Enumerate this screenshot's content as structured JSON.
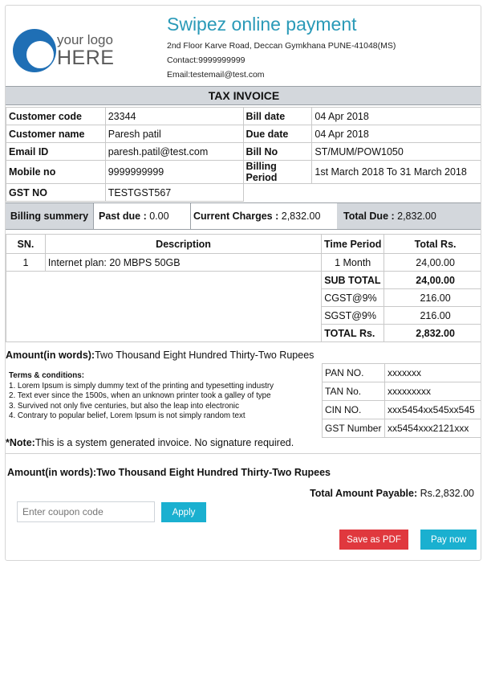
{
  "header": {
    "logo_small": "your logo",
    "logo_big": "HERE",
    "company": "Swipez online payment",
    "address": "2nd Floor Karve Road, Deccan Gymkhana PUNE-41048(MS)",
    "contact": "Contact:9999999999",
    "email": "Email:testemail@test.com"
  },
  "invoice_title": "TAX INVOICE",
  "customer": {
    "code_label": "Customer code",
    "code": "23344",
    "name_label": "Customer name",
    "name": "Paresh patil",
    "email_label": "Email ID",
    "email": "paresh.patil@test.com",
    "mobile_label": "Mobile no",
    "mobile": "9999999999",
    "gst_label": "GST NO",
    "gst": "TESTGST567"
  },
  "bill": {
    "date_label": "Bill date",
    "date": "04 Apr 2018",
    "due_label": "Due date",
    "due": "04 Apr 2018",
    "no_label": "Bill No",
    "no": "ST/MUM/POW1050",
    "period_label": "Billing Period",
    "period": "1st March 2018 To 31 March 2018"
  },
  "summary": {
    "label": "Billing summery",
    "past_label": "Past due :",
    "past": " 0.00",
    "current_label": "Current Charges :",
    "current": " 2,832.00",
    "total_label": "Total Due :",
    "total": " 2,832.00"
  },
  "table": {
    "headers": [
      "SN.",
      "Description",
      "Time Period",
      "Total Rs."
    ],
    "rows": [
      {
        "sn": "1",
        "desc": "Internet plan: 20 MBPS 50GB",
        "period": "1 Month",
        "total": "24,00.00"
      }
    ],
    "subtotal_label": "SUB TOTAL",
    "subtotal": "24,00.00",
    "cgst_label": "CGST@9%",
    "cgst": "216.00",
    "sgst_label": "SGST@9%",
    "sgst": "216.00",
    "total_label": "TOTAL Rs.",
    "total": "2,832.00"
  },
  "amount_words_label": "Amount(in words):",
  "amount_words": "Two Thousand Eight Hundred Thirty-Two Rupees",
  "terms": {
    "title": "Terms & conditions:",
    "lines": [
      "1. Lorem Ipsum is simply dummy text of the printing and typesetting industry",
      "2. Text ever since the 1500s, when an unknown printer took a galley of type",
      "3. Survived not only five centuries, but also the leap into electronic",
      "4. Contrary to popular belief, Lorem Ipsum is not simply random text"
    ]
  },
  "ids": {
    "pan_label": "PAN NO.",
    "pan": "xxxxxxx",
    "tan_label": "TAN No.",
    "tan": "xxxxxxxxx",
    "cin_label": "CIN NO.",
    "cin": "xxx5454xx545xx545",
    "gst_label": "GST Number",
    "gst": "xx5454xxx2121xxx"
  },
  "note_label": "*Note:",
  "note": "This is a system generated invoice. No signature required.",
  "amount_words_full": "Amount(in words):Two Thousand Eight Hundred Thirty-Two Rupees",
  "total_payable_label": "Total Amount Payable:",
  "total_payable": " Rs.2,832.00",
  "coupon_placeholder": "Enter coupon code",
  "buttons": {
    "apply": "Apply",
    "save_pdf": "Save as PDF",
    "pay_now": "Pay now"
  },
  "colors": {
    "brand": "#2a9ab8",
    "button_blue": "#1ab0d0",
    "button_red": "#e0383e",
    "band_grey": "#d3d7dc"
  }
}
